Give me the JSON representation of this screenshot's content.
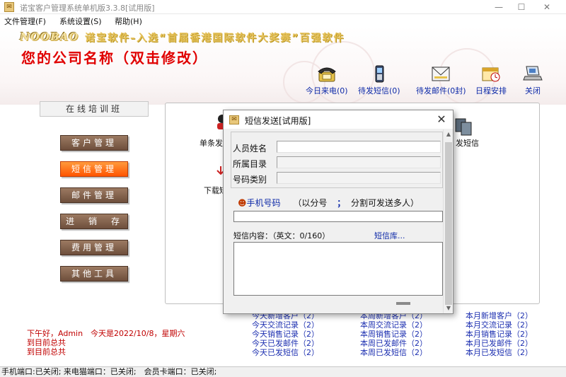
{
  "window": {
    "title": "诺宝客户管理系统单机版3.3.8[试用版]",
    "icon": "app-logo-icon",
    "controls": [
      "—",
      "☐",
      "✕"
    ]
  },
  "menu": [
    "文件管理(F)",
    "系统设置(S)",
    "帮助(H)"
  ],
  "banner": {
    "logo": "NOOBAO",
    "slogan": "诺宝软件–入选“首届香港国际软件大奖赛”百强软件",
    "company": "您的公司名称（双击修改）"
  },
  "toolbar": [
    {
      "label": "今日来电(0)",
      "icon": "phone-icon"
    },
    {
      "label": "待发短信(0)",
      "icon": "mobile-phone-icon"
    },
    {
      "label": "待发邮件(0封)",
      "icon": "mail-icon"
    },
    {
      "label": "日程安排",
      "icon": "calendar-clock-icon"
    },
    {
      "label": "关闭",
      "icon": "close-laptop-icon"
    }
  ],
  "sidebar": {
    "title": "在线培训班",
    "buttons": [
      "客户管理",
      "短信管理",
      "邮件管理",
      "进　销　存",
      "费用管理",
      "其他工具"
    ],
    "active": "短信管理"
  },
  "background_items": [
    "单条发",
    "下载短",
    "发短信"
  ],
  "stats": {
    "today": [
      "今天新增客户（2）",
      "今天交流记录（2）",
      "今天销售记录（2）",
      "今天已发邮件（2）",
      "今天已发短信（2）"
    ],
    "week": [
      "本周新增客户（2）",
      "本周交流记录（2）",
      "本周销售记录（2）",
      "本周已发邮件（2）",
      "本周已发短信（2）"
    ],
    "month": [
      "本月新增客户（2）",
      "本月交流记录（2）",
      "本月销售记录（2）",
      "本月已发邮件（2）",
      "本月已发短信（2）"
    ]
  },
  "greeting": [
    "下午好，Admin　今天是2022/10/8，星期六",
    "到目前总共",
    "到目前总共"
  ],
  "statusbar": "手机端口:已关闭; 来电猫端口：已关闭;　会员卡端口：已关闭;",
  "dialog": {
    "title": "短信发送[试用版]",
    "fields": [
      {
        "label": "人员姓名",
        "value": ""
      },
      {
        "label": "所属目录",
        "value": ""
      },
      {
        "label": "号码类别",
        "value": ""
      }
    ],
    "phone_label": "手机号码",
    "phone_hint": "（以分号",
    "phone_sep": "；",
    "phone_hint2": "分割可发送多人）",
    "phone_value": "",
    "sms_label": "短信内容：（英文：0/160）",
    "sms_library": "短信库...",
    "sms_value": ""
  }
}
